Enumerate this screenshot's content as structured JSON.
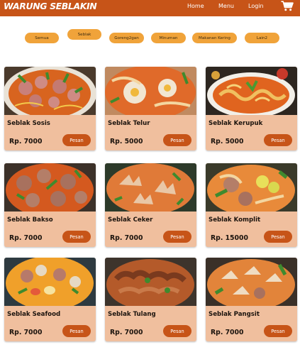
{
  "navbar": {
    "brand": "WARUNG SEBLAKIN",
    "links": [
      "Home",
      "Menu",
      "Login"
    ]
  },
  "categories": [
    "Semua",
    "Seblak",
    "Goreng2gan",
    "Minuman",
    "Makanan Kering",
    "Lain2"
  ],
  "products": [
    {
      "name": "Seblak Sosis",
      "price": "Rp. 7000",
      "button": "Pesan"
    },
    {
      "name": "Seblak Telur",
      "price": "Rp. 5000",
      "button": "Pesan"
    },
    {
      "name": "Seblak Kerupuk",
      "price": "Rp. 5000",
      "button": "Pesan"
    },
    {
      "name": "Seblak Bakso",
      "price": "Rp. 7000",
      "button": "Pesan"
    },
    {
      "name": "Seblak Ceker",
      "price": "Rp. 7000",
      "button": "Pesan"
    },
    {
      "name": "Seblak Komplit",
      "price": "Rp. 15000",
      "button": "Pesan"
    },
    {
      "name": "Seblak Seafood",
      "price": "Rp. 7000",
      "button": "Pesan"
    },
    {
      "name": "Seblak Tulang",
      "price": "Rp. 7000",
      "button": "Pesan"
    },
    {
      "name": "Seblak Pangsit",
      "price": "Rp. 7000",
      "button": "Pesan"
    }
  ],
  "icons": {
    "cart": "shopping-cart-icon"
  },
  "colors": {
    "primary": "#c75418",
    "category": "#f0a33a",
    "card": "#f0bf9e"
  }
}
